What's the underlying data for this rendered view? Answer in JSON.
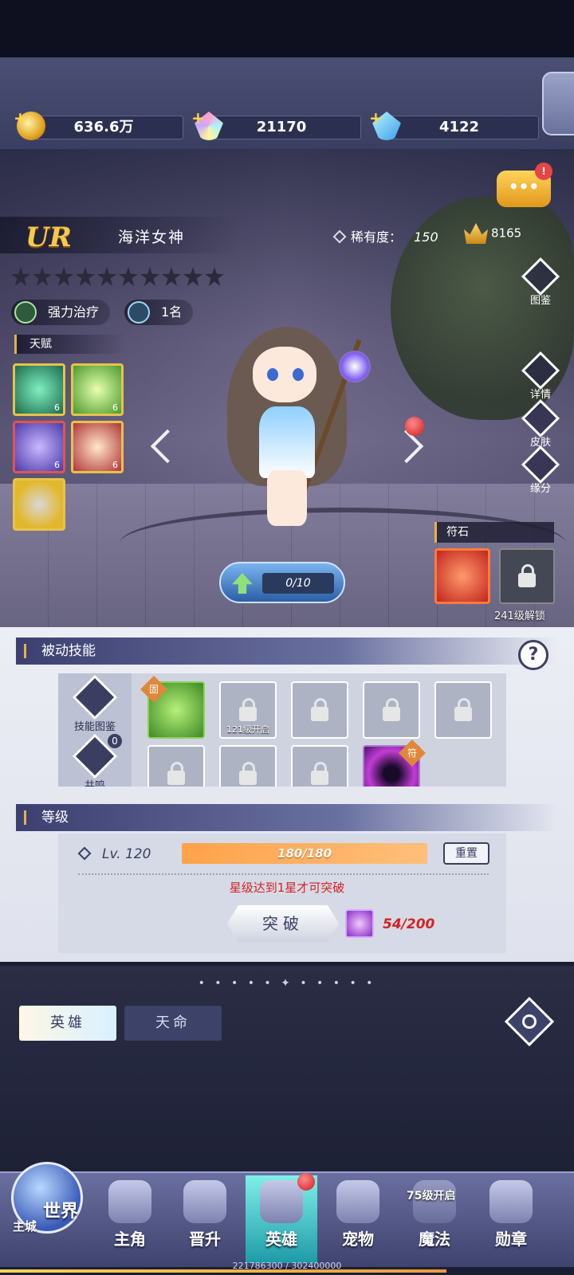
{
  "resources": {
    "gold": "636.6万",
    "rainbow_gem": "21170",
    "diamond": "4122"
  },
  "hero": {
    "rank": "UR",
    "name": "海洋女神",
    "rarity_label": "稀有度：",
    "rarity_value": "150",
    "power": "8165",
    "stars_total": 10,
    "role_tag": "强力治疗",
    "rank_tag": "1名"
  },
  "chat": {
    "icon": "chat-bubble-icon",
    "label": "•••",
    "badge": "!"
  },
  "talents": {
    "title": "天赋",
    "items": [
      {
        "name": "talent-clover",
        "level": "6"
      },
      {
        "name": "talent-heal-cross",
        "level": "6"
      },
      {
        "name": "talent-wave",
        "level": "6"
      },
      {
        "name": "talent-angel",
        "level": "6"
      },
      {
        "name": "talent-orb",
        "level": ""
      }
    ]
  },
  "side_buttons": [
    {
      "label": "图鉴",
      "icon": "codex-icon"
    },
    {
      "label": "详情",
      "icon": "magnifier-icon"
    },
    {
      "label": "皮肤",
      "icon": "skin-icon"
    },
    {
      "label": "缘分",
      "icon": "heart-icon"
    }
  ],
  "rune": {
    "title": "符石",
    "locked_note": "241级解锁"
  },
  "levelup": {
    "progress": "0/10"
  },
  "passive": {
    "title": "被动技能",
    "help": "?",
    "codex_label": "技能图鉴",
    "resonance_label": "共鸣",
    "resonance_count": "0",
    "slot_fixed_tag": "固",
    "slot_locked_note": "121级开启",
    "slot_symbol_tag": "符"
  },
  "level": {
    "title": "等级",
    "level_text": "Lv.  120",
    "exp": "180/180",
    "reset": "重置",
    "warning": "星级达到1星才可突破",
    "break_button": "突破",
    "material_count": "54/200"
  },
  "tabs": {
    "dots": "• • • • • ✦ • • • • •",
    "hero": "英雄",
    "destiny": "天命"
  },
  "nav": {
    "world": "世界",
    "city": "主城",
    "items": [
      "主角",
      "晋升",
      "英雄",
      "宠物",
      "魔法",
      "勋章"
    ],
    "magic_note": "75级开启",
    "xp": "221786300 / 302400000"
  }
}
